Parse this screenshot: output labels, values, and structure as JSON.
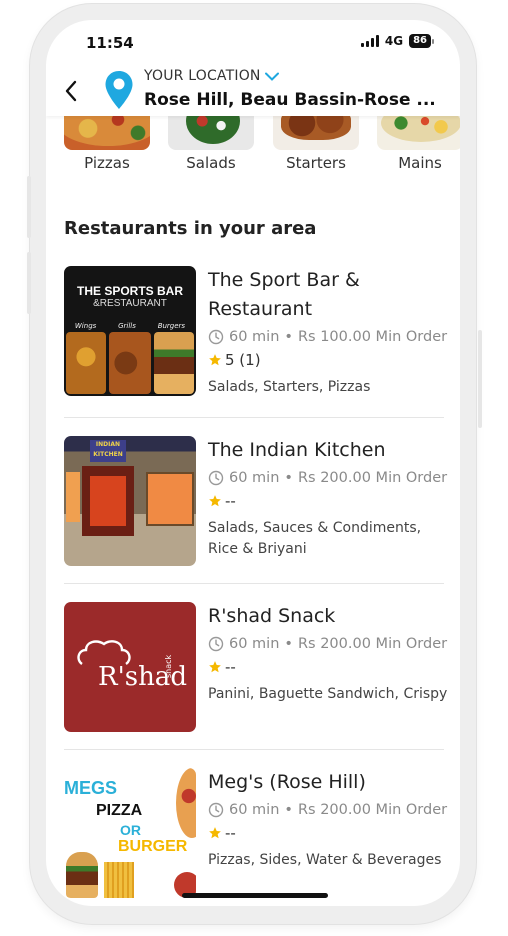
{
  "status_bar": {
    "time": "11:54",
    "network": "4G",
    "battery": "86"
  },
  "header": {
    "location_label": "YOUR LOCATION",
    "location_value": "Rose Hill, Beau Bassin-Rose ..."
  },
  "categories": [
    {
      "label": "Pizzas"
    },
    {
      "label": "Salads"
    },
    {
      "label": "Starters"
    },
    {
      "label": "Mains"
    }
  ],
  "section_title": "Restaurants in your area",
  "restaurants": [
    {
      "name": "The Sport Bar & Restaurant",
      "time": "60 min",
      "min_order": "Rs 100.00 Min Order",
      "rating": "5 (1)",
      "tags": "Salads, Starters, Pizzas",
      "image_text": {
        "line1": "THE SPORTS BAR",
        "line2": "&RESTAURANT",
        "items": [
          "Wings",
          "Grills",
          "Burgers"
        ]
      }
    },
    {
      "name": "The Indian Kitchen",
      "time": "60 min",
      "min_order": "Rs 200.00 Min Order",
      "rating": "--",
      "tags": "Salads, Sauces & Condiments, Rice & Briyani",
      "image_text": {
        "sign": "INDIAN KITCHEN"
      }
    },
    {
      "name": "R'shad Snack",
      "time": "60 min",
      "min_order": "Rs 200.00 Min Order",
      "rating": "--",
      "tags": "Panini, Baguette Sandwich, Crispy",
      "image_text": {
        "logo": "R'shad",
        "sub": "snack"
      }
    },
    {
      "name": "Meg's (Rose Hill)",
      "time": "60 min",
      "min_order": "Rs 200.00 Min Order",
      "rating": "--",
      "tags": "Pizzas, Sides, Water & Beverages",
      "image_text": {
        "l1": "MEGS",
        "l2": "PIZZA",
        "l3": "OR",
        "l4": "BURGER"
      }
    }
  ],
  "colors": {
    "accent": "#1fa8e0",
    "star": "#f5b800",
    "rshad_bg": "#9b2a2a"
  }
}
